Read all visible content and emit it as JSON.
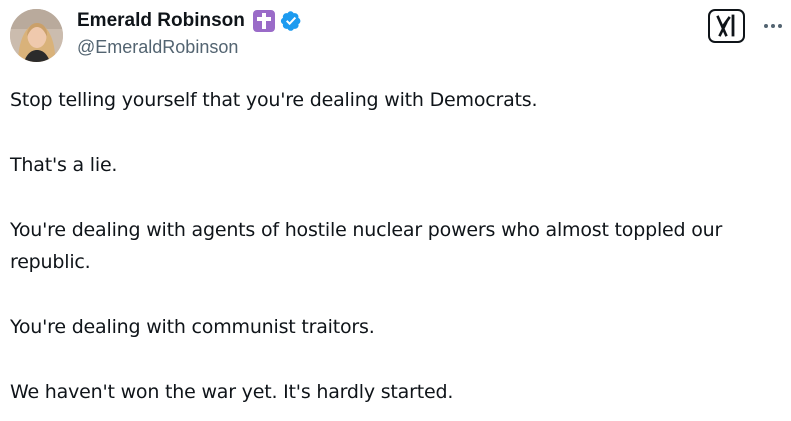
{
  "author": {
    "display_name": "Emerald Robinson",
    "handle": "@EmeraldRobinson",
    "badges": [
      "latin-cross-icon",
      "verified-badge-icon"
    ],
    "verified_color": "#1d9bf0",
    "cross_badge_color": "#9a6bc8"
  },
  "actions": {
    "grok_icon": "grok-xai-icon",
    "more_icon": "more-options-icon"
  },
  "tweet": {
    "paragraphs": [
      "Stop telling yourself that you're dealing with Democrats.",
      "That's a lie.",
      "You're dealing with agents of hostile nuclear powers who almost toppled our republic.",
      "You're dealing with communist traitors.",
      "We haven't won the war yet. It's hardly started."
    ]
  }
}
